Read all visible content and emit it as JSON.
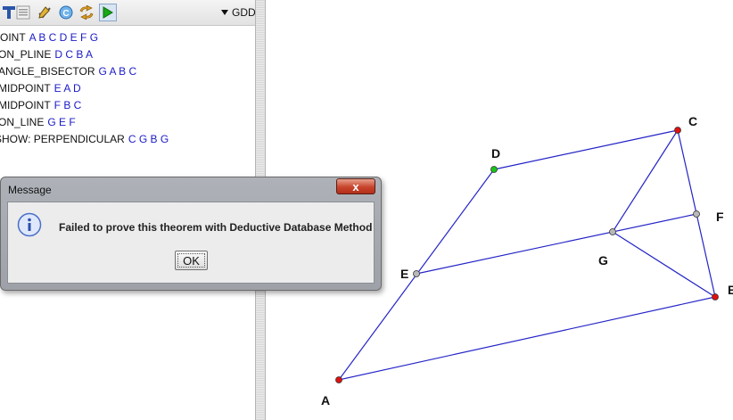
{
  "toolbar": {
    "icons": [
      "text-tool-icon",
      "list-icon",
      "pen-check-icon",
      "copyright-c-icon",
      "refresh-icon",
      "run-play-icon"
    ],
    "method_select": "GDD"
  },
  "code": [
    {
      "kw": "POINT",
      "args": "A B C D E F G"
    },
    {
      "kw": "ON_PLINE",
      "args": "D C B A"
    },
    {
      "kw": "ANGLE_BISECTOR",
      "args": "G A B C"
    },
    {
      "kw": "MIDPOINT",
      "args": "E A D"
    },
    {
      "kw": "MIDPOINT",
      "args": "F B C"
    },
    {
      "kw": "ON_LINE",
      "args": "G E F"
    },
    {
      "kw": "SHOW: PERPENDICULAR",
      "args": "C G B G"
    }
  ],
  "dialog": {
    "title": "Message",
    "close_label": "x",
    "message": "Failed to prove this theorem with Deductive Database Method",
    "ok_label": "OK"
  },
  "figure": {
    "points": {
      "A": {
        "label": "A",
        "color": "#e01010"
      },
      "B": {
        "label": "B",
        "color": "#e01010"
      },
      "C": {
        "label": "C",
        "color": "#e01010"
      },
      "D": {
        "label": "D",
        "color": "#19c419"
      },
      "E": {
        "label": "E",
        "color": "#b8b8b8"
      },
      "F": {
        "label": "F",
        "color": "#b8b8b8"
      },
      "G": {
        "label": "G",
        "color": "#b8b8b8"
      }
    },
    "segments": [
      [
        "A",
        "B"
      ],
      [
        "A",
        "D"
      ],
      [
        "D",
        "C"
      ],
      [
        "C",
        "B"
      ],
      [
        "E",
        "F"
      ],
      [
        "C",
        "G"
      ],
      [
        "G",
        "B"
      ]
    ],
    "line_color": "#2424c8"
  }
}
